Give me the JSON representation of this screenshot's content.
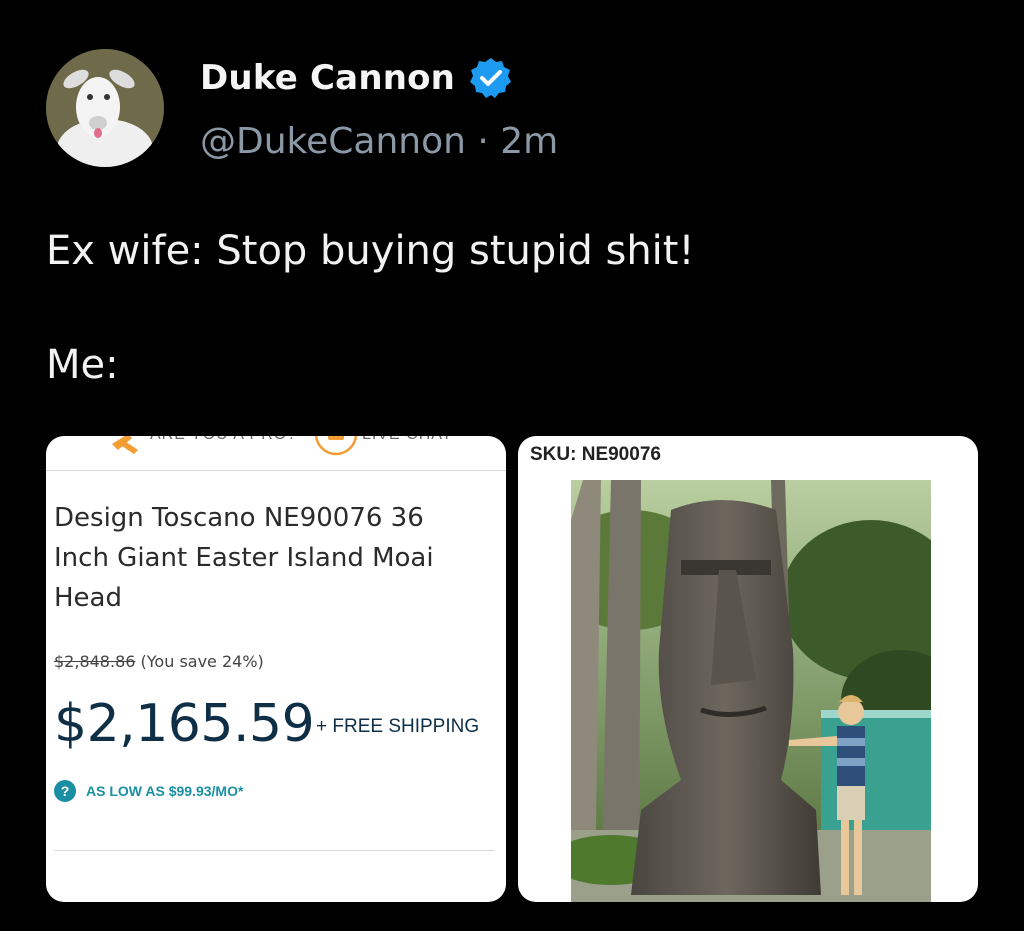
{
  "author": {
    "name": "Duke Cannon",
    "handle": "@DukeCannon",
    "separator": "·",
    "time": "2m",
    "verified_color": "#1d9bf0"
  },
  "tweet": {
    "line1": "Ex wife: Stop buying stupid shit!",
    "line2": "Me:"
  },
  "product_card": {
    "clipped_left_label": "ARE YOU A PRO?",
    "clipped_right_label": "LIVE CHAT",
    "title": "Design Toscano NE90076 36 Inch Giant Easter Island Moai Head",
    "original_price": "$2,848.86",
    "savings": "(You save 24%)",
    "price": "$2,165.59",
    "shipping": "+ FREE SHIPPING",
    "finance_icon": "?",
    "finance": "AS LOW AS $99.93/MO*",
    "accent_color": "#f39c34",
    "price_color": "#0f2f47",
    "finance_color": "#1a8fa3"
  },
  "photo_card": {
    "sku": "SKU: NE90076",
    "photo_icon": "moai-statue-photo"
  }
}
